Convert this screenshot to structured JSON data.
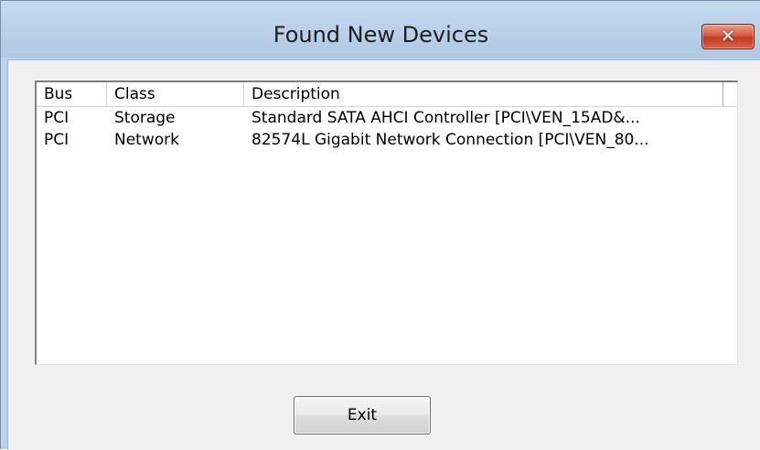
{
  "window": {
    "title": "Found New Devices",
    "close_glyph": "✕",
    "close_icon": "close-icon"
  },
  "list": {
    "columns": [
      "Bus",
      "Class",
      "Description"
    ],
    "rows": [
      {
        "bus": "PCI",
        "class": "Storage",
        "description": "Standard SATA AHCI Controller [PCI\\VEN_15AD&..."
      },
      {
        "bus": "PCI",
        "class": "Network",
        "description": "82574L Gigabit Network Connection [PCI\\VEN_80..."
      }
    ]
  },
  "buttons": {
    "exit_label": "Exit"
  },
  "colors": {
    "titlebar": "#b9d1ea",
    "client": "#f0f0f0",
    "close_button": "#c7432a"
  }
}
